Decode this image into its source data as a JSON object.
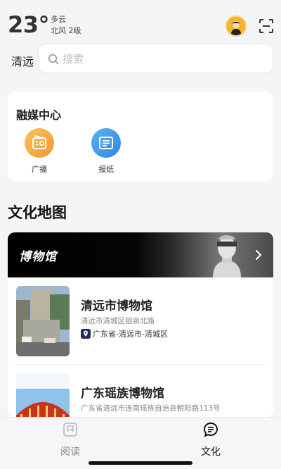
{
  "weather": {
    "temperature": "23°",
    "condition": "多云",
    "wind": "北风 2级"
  },
  "location": {
    "city": "清远"
  },
  "search": {
    "placeholder": "搜索"
  },
  "media_center": {
    "title": "融媒中心",
    "items": [
      {
        "label": "广播",
        "icon": "radio-icon",
        "color": "#f4a83a"
      },
      {
        "label": "报纸",
        "icon": "newspaper-icon",
        "color": "#3d9be9"
      }
    ]
  },
  "culture_map": {
    "title": "文化地图",
    "banner_title": "博物馆",
    "museums": [
      {
        "name": "清远市博物馆",
        "address": "清远市清城区银泉北路",
        "region": "广东省-清远市-清城区"
      },
      {
        "name": "广东瑶族博物馆",
        "address": "广东省清远市连南瑶族自治县朝阳路113号"
      }
    ]
  },
  "bottom_nav": {
    "items": [
      {
        "label": "阅读",
        "icon": "book-icon",
        "active": false
      },
      {
        "label": "文化",
        "icon": "culture-icon",
        "active": true
      }
    ]
  },
  "colors": {
    "accent_orange": "#f4a83a",
    "accent_blue": "#3d9be9",
    "active_nav": "#111111",
    "inactive_nav": "#888888"
  }
}
